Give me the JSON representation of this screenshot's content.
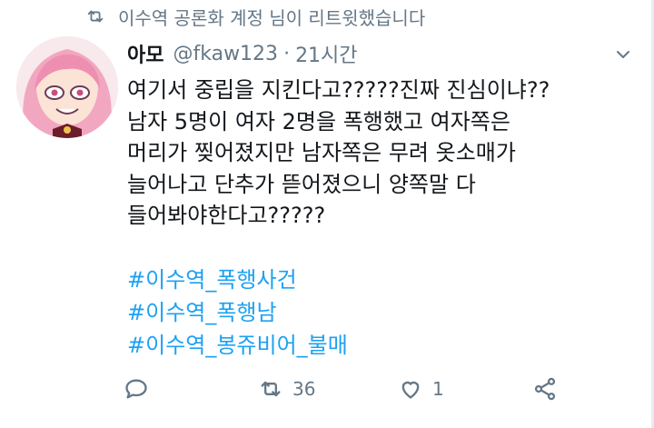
{
  "retweet_banner": {
    "icon": "retweet-icon",
    "text": "이수역 공론화 계정 님이 리트윗했습니다"
  },
  "tweet": {
    "author": {
      "display_name": "아모",
      "handle": "@fkaw123",
      "separator": "·",
      "time": "21시간"
    },
    "body_lines": [
      "여기서 중립을 지킨다고?????진짜 진심이냐??",
      "남자 5명이 여자 2명을 폭행했고 여자쪽은",
      "머리가 찢어졌지만 남자쪽은 무려 옷소매가",
      "늘어나고 단추가 뜯어졌으니 양쪽말 다",
      "들어봐야한다고?????"
    ],
    "hashtags": [
      "#이수역_폭행사건",
      "#이수역_폭행남",
      "#이수역_봉쥬비어_불매"
    ],
    "actions": {
      "reply_icon": "reply-icon",
      "retweet_icon": "retweet-icon",
      "retweet_count": "36",
      "like_icon": "heart-icon",
      "like_count": "1",
      "share_icon": "share-icon"
    }
  },
  "colors": {
    "accent": "#1da1f2",
    "muted": "#657786",
    "text": "#14171a"
  }
}
